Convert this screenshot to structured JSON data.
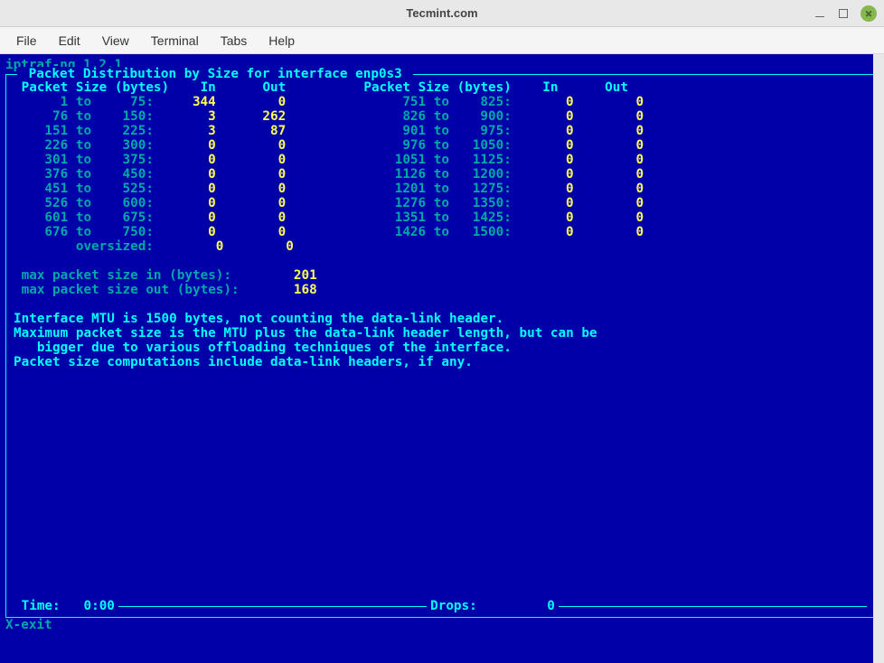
{
  "window": {
    "title": "Tecmint.com"
  },
  "menu": {
    "file": "File",
    "edit": "Edit",
    "view": "View",
    "terminal": "Terminal",
    "tabs": "Tabs",
    "help": "Help"
  },
  "app": {
    "title": "iptraf-ng 1.2.1",
    "box_title": " Packet Distribution by Size for interface enp0s3 "
  },
  "headers": {
    "size": "Packet Size (bytes)",
    "in": "In",
    "out": "Out"
  },
  "rows_left": [
    {
      "from": "1",
      "to": "75",
      "in": "344",
      "out": "0"
    },
    {
      "from": "76",
      "to": "150",
      "in": "3",
      "out": "262"
    },
    {
      "from": "151",
      "to": "225",
      "in": "3",
      "out": "87"
    },
    {
      "from": "226",
      "to": "300",
      "in": "0",
      "out": "0"
    },
    {
      "from": "301",
      "to": "375",
      "in": "0",
      "out": "0"
    },
    {
      "from": "376",
      "to": "450",
      "in": "0",
      "out": "0"
    },
    {
      "from": "451",
      "to": "525",
      "in": "0",
      "out": "0"
    },
    {
      "from": "526",
      "to": "600",
      "in": "0",
      "out": "0"
    },
    {
      "from": "601",
      "to": "675",
      "in": "0",
      "out": "0"
    },
    {
      "from": "676",
      "to": "750",
      "in": "0",
      "out": "0"
    }
  ],
  "rows_right": [
    {
      "from": "751",
      "to": "825",
      "in": "0",
      "out": "0"
    },
    {
      "from": "826",
      "to": "900",
      "in": "0",
      "out": "0"
    },
    {
      "from": "901",
      "to": "975",
      "in": "0",
      "out": "0"
    },
    {
      "from": "976",
      "to": "1050",
      "in": "0",
      "out": "0"
    },
    {
      "from": "1051",
      "to": "1125",
      "in": "0",
      "out": "0"
    },
    {
      "from": "1126",
      "to": "1200",
      "in": "0",
      "out": "0"
    },
    {
      "from": "1201",
      "to": "1275",
      "in": "0",
      "out": "0"
    },
    {
      "from": "1276",
      "to": "1350",
      "in": "0",
      "out": "0"
    },
    {
      "from": "1351",
      "to": "1425",
      "in": "0",
      "out": "0"
    },
    {
      "from": "1426",
      "to": "1500",
      "in": "0",
      "out": "0"
    }
  ],
  "oversized": {
    "label": "oversized:",
    "in": "0",
    "out": "0"
  },
  "stats": {
    "max_in_lbl": "max packet size in (bytes):",
    "max_in": "201",
    "max_out_lbl": "max packet size out (bytes):",
    "max_out": "168"
  },
  "info": {
    "l1": "Interface MTU is 1500 bytes, not counting the data-link header.",
    "l2": "Maximum packet size is the MTU plus the data-link header length, but can be",
    "l3": "   bigger due to various offloading techniques of the interface.",
    "l4": "Packet size computations include data-link headers, if any."
  },
  "status": {
    "time_lbl": "Time:",
    "time": "0:00",
    "drops_lbl": "Drops:",
    "drops": "0"
  },
  "exit": "X-exit"
}
